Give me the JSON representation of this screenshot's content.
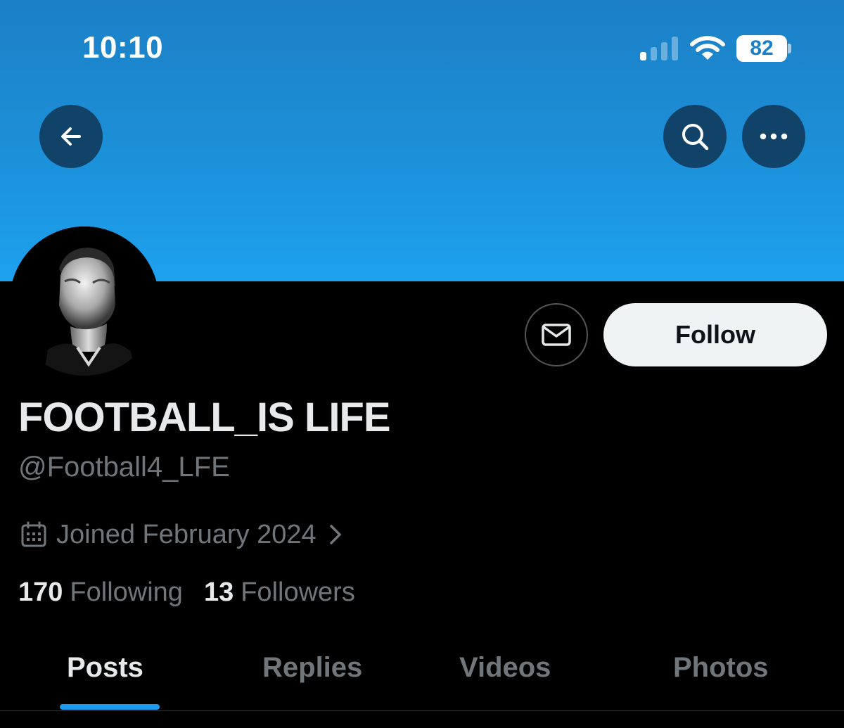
{
  "status_bar": {
    "time": "10:10",
    "battery": "82",
    "signal_bars_active": 1,
    "signal_bars_total": 4
  },
  "header": {
    "back_icon": "arrow-left-icon",
    "search_icon": "search-icon",
    "more_icon": "more-horizontal-icon",
    "banner_color": "#1d9bf0"
  },
  "profile": {
    "display_name": "FOOTBALL_IS LIFE",
    "handle": "@Football4_LFE",
    "joined": "Joined February 2024",
    "following_count": "170",
    "following_label": "Following",
    "followers_count": "13",
    "followers_label": "Followers"
  },
  "actions": {
    "message_icon": "envelope-icon",
    "follow_label": "Follow"
  },
  "tabs": [
    {
      "label": "Posts",
      "active": true
    },
    {
      "label": "Replies",
      "active": false
    },
    {
      "label": "Videos",
      "active": false
    },
    {
      "label": "Photos",
      "active": false
    }
  ],
  "colors": {
    "accent": "#1d9bf0",
    "text_primary": "#e7e9ea",
    "text_secondary": "#71767b",
    "background": "#000000"
  }
}
